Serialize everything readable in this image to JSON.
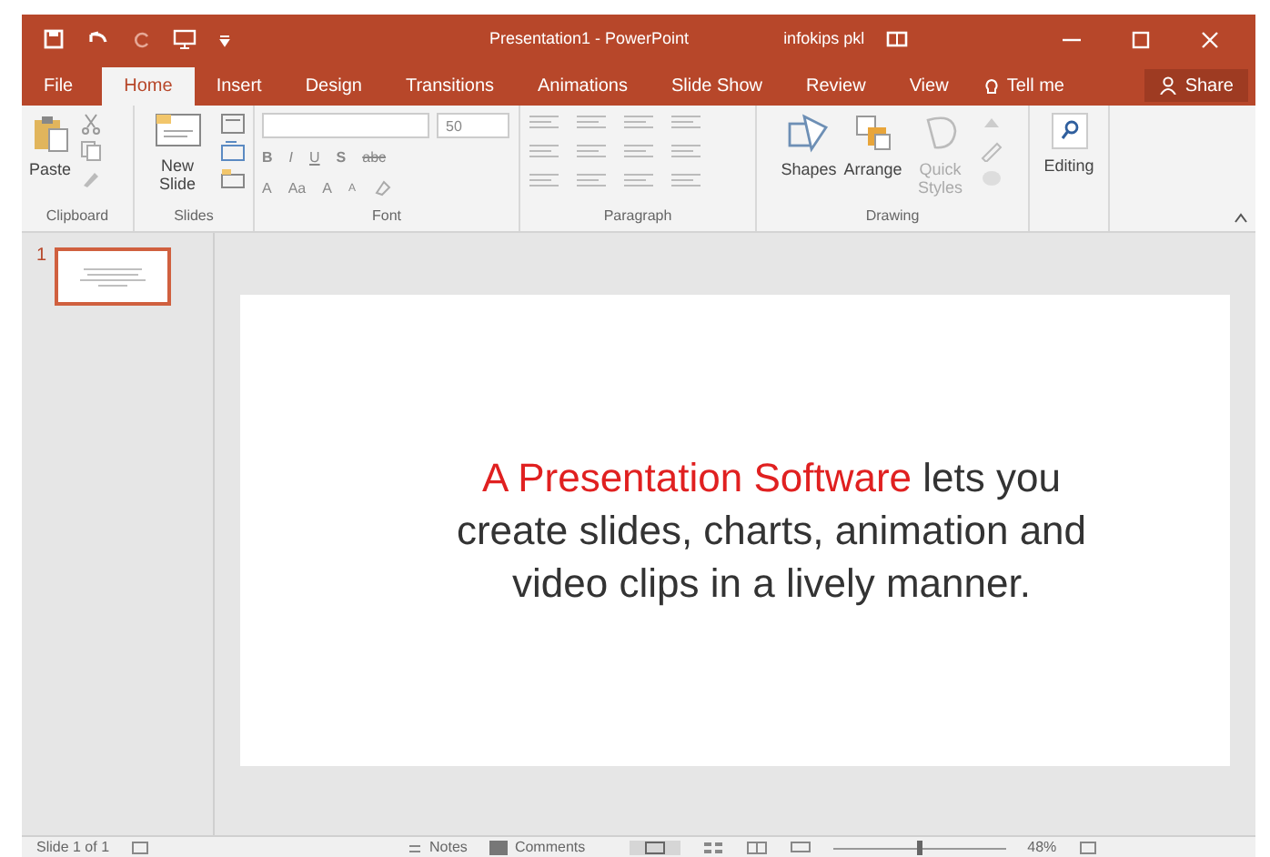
{
  "window": {
    "title": "Presentation1 - PowerPoint",
    "user": "infokips pkl"
  },
  "tabs": [
    {
      "label": "File",
      "selected": false
    },
    {
      "label": "Home",
      "selected": true
    },
    {
      "label": "Insert",
      "selected": false
    },
    {
      "label": "Design",
      "selected": false
    },
    {
      "label": "Transitions",
      "selected": false
    },
    {
      "label": "Animations",
      "selected": false
    },
    {
      "label": "Slide Show",
      "selected": false
    },
    {
      "label": "Review",
      "selected": false
    },
    {
      "label": "View",
      "selected": false
    }
  ],
  "tell_me": "Tell me",
  "share": "Share",
  "ribbon": {
    "clipboard": {
      "paste": "Paste",
      "group": "Clipboard"
    },
    "slides": {
      "new_slide": "New Slide",
      "group": "Slides"
    },
    "font": {
      "font_size": "50",
      "format_buttons": [
        "B",
        "I",
        "U",
        "S",
        "abc"
      ],
      "size_buttons": [
        "A",
        "Aa",
        "A",
        "A"
      ],
      "group": "Font"
    },
    "paragraph": {
      "group": "Paragraph"
    },
    "drawing": {
      "shapes": "Shapes",
      "arrange": "Arrange",
      "quick_styles": "Quick Styles",
      "group": "Drawing"
    },
    "editing": {
      "label": "Editing"
    }
  },
  "thumbnails": [
    {
      "number": "1",
      "selected": true
    }
  ],
  "slide": {
    "highlight": "A Presentation Software",
    "text": " lets you create slides, charts, animation and video clips in a lively manner."
  },
  "status_bar": {
    "slide_count": "Slide 1 of 1",
    "notes": "Notes",
    "comments": "Comments",
    "zoom": "48%",
    "zoom_slider": {
      "level": 0.5
    }
  }
}
